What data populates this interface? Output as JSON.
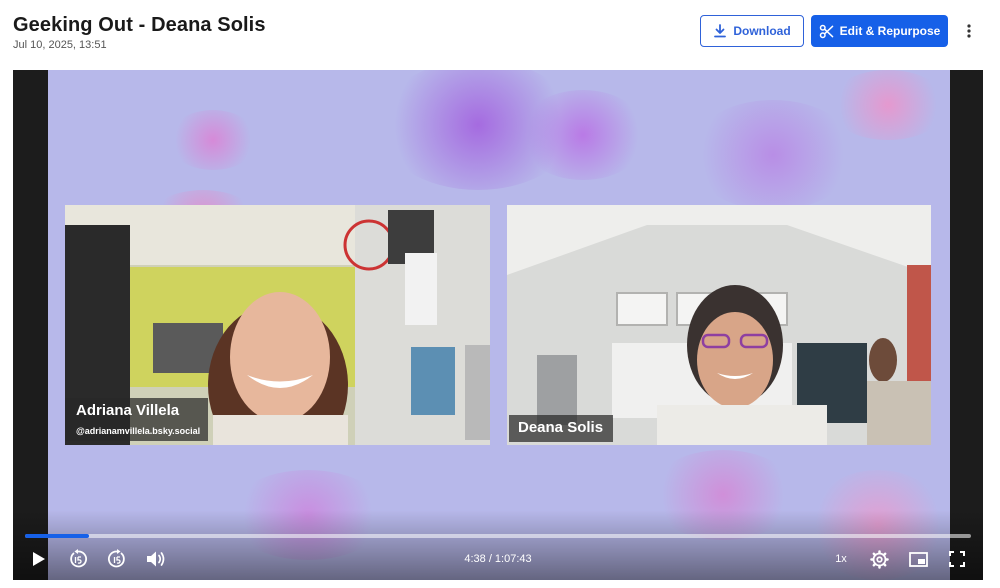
{
  "header": {
    "title": "Geeking Out - Deana Solis",
    "date": "Jul 10, 2025, 13:51",
    "download_label": "Download",
    "edit_label": "Edit & Repurpose"
  },
  "video": {
    "participants": [
      {
        "name": "Adriana Villela",
        "handle": "@adrianamvillela.bsky.social"
      },
      {
        "name": "Deana Solis"
      }
    ]
  },
  "player": {
    "time": "4:38 / 1:07:43",
    "speed": "1x",
    "progress": 0.068,
    "accent": "#1660e8"
  },
  "icons": [
    "download-icon",
    "scissors-icon",
    "more-vertical-icon",
    "play-icon",
    "rewind-15-icon",
    "forward-15-icon",
    "volume-icon",
    "settings-icon",
    "picture-in-picture-icon",
    "fullscreen-icon"
  ]
}
